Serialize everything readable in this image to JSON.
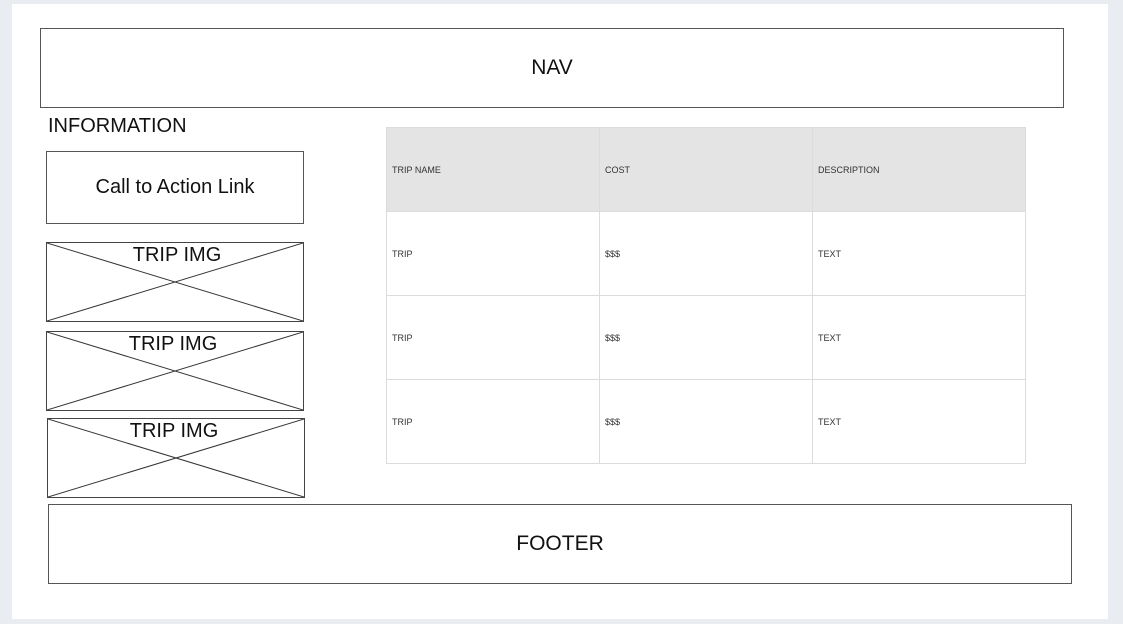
{
  "nav": {
    "label": "NAV"
  },
  "information": {
    "heading": "INFORMATION"
  },
  "cta": {
    "label": "Call to Action Link"
  },
  "trip_images": [
    {
      "label": "TRIP IMG"
    },
    {
      "label": "TRIP IMG"
    },
    {
      "label": "TRIP IMG"
    }
  ],
  "table": {
    "headers": [
      "TRIP NAME",
      "COST",
      "DESCRIPTION"
    ],
    "rows": [
      [
        "TRIP",
        "$$$",
        "TEXT"
      ],
      [
        "TRIP",
        "$$$",
        "TEXT"
      ],
      [
        "TRIP",
        "$$$",
        "TEXT"
      ]
    ]
  },
  "footer": {
    "label": "FOOTER"
  }
}
